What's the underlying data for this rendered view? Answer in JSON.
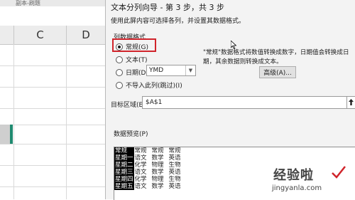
{
  "sheet": {
    "top_text": "副本-刷题",
    "columns": [
      "C",
      "D"
    ]
  },
  "dialog": {
    "title": "文本分列向导 - 第 3 步，共 3 步",
    "instruction": "使用此屏内容可选择各列，并设置其数据格式。",
    "group_label": "列数据格式",
    "options": [
      {
        "label": "常规(G)",
        "selected": true
      },
      {
        "label": "文本(T)",
        "selected": false
      },
      {
        "label": "日期(D):",
        "selected": false
      },
      {
        "label": "不导入此列(跳过)(I)",
        "selected": false
      }
    ],
    "date_format": "YMD",
    "description": "\"常规\"数据格式将数值转换成数字，日期值会转换成日期，其余数据则转换成文本。",
    "advanced_button": "高级(A)...",
    "target_label": "目标区域(E):",
    "target_value": "$A$1",
    "preview_label": "数据预览(P)",
    "preview": {
      "header": [
        "常规",
        "常规",
        "常规",
        "常规"
      ],
      "rows": [
        [
          "星期一",
          "语文",
          "数学",
          "英语"
        ],
        [
          "星期二",
          "化学",
          "物理",
          "生物"
        ],
        [
          "星期三",
          "语文",
          "数学",
          "英语"
        ],
        [
          "星期四",
          "化学",
          "物理",
          "生物"
        ],
        [
          "星期五",
          "语文",
          "数学",
          "英语"
        ]
      ]
    }
  },
  "watermark": {
    "main": "经验啦",
    "sub": "jingyanla.com"
  }
}
